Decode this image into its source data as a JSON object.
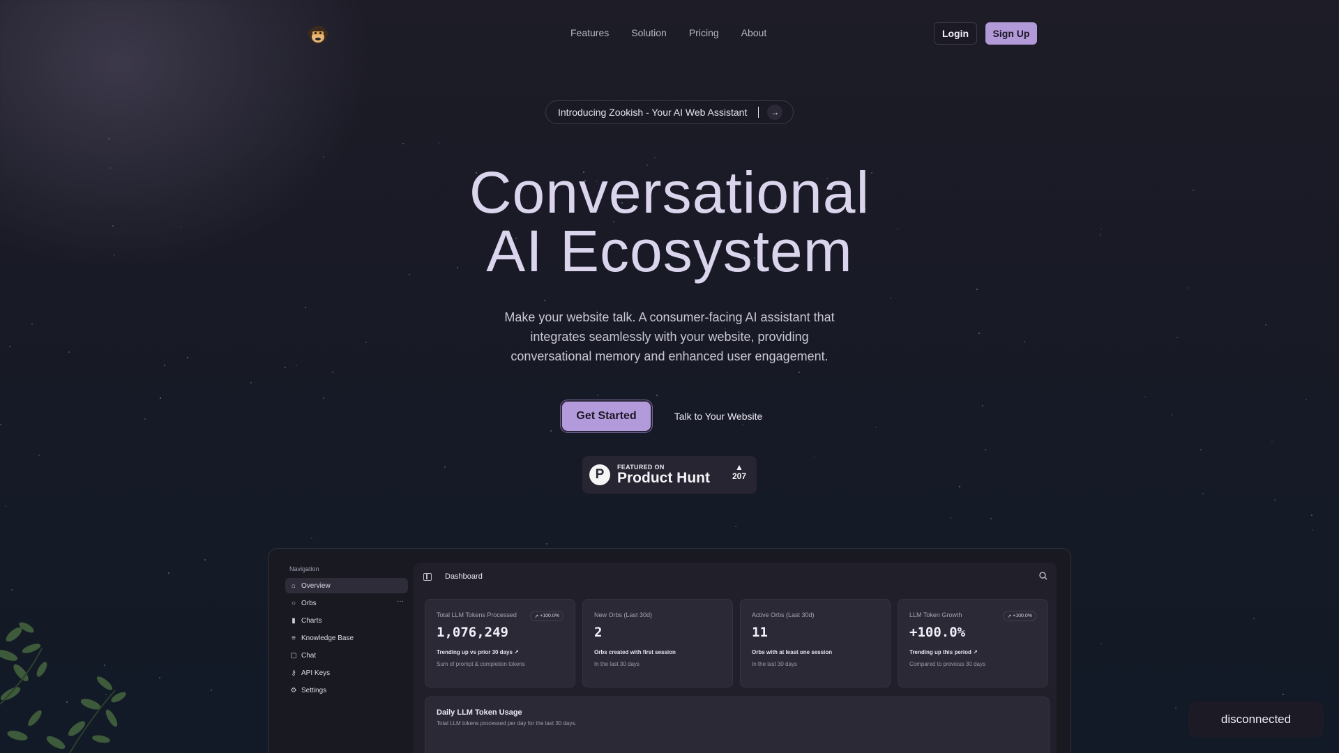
{
  "nav": {
    "links": [
      "Features",
      "Solution",
      "Pricing",
      "About"
    ],
    "login_label": "Login",
    "signup_label": "Sign Up"
  },
  "announcement": {
    "text": "Introducing Zookish - Your AI Web Assistant"
  },
  "hero": {
    "title_line1": "Conversational",
    "title_line2": "AI Ecosystem",
    "subtitle": "Make your website talk. A consumer-facing AI assistant that integrates seamlessly with your website, providing conversational memory and enhanced user engagement.",
    "cta_primary": "Get Started",
    "cta_secondary": "Talk to Your Website"
  },
  "product_hunt": {
    "featured_on": "FEATURED ON",
    "name": "Product Hunt",
    "letter": "P",
    "upvotes": "207"
  },
  "dashboard": {
    "nav_heading": "Navigation",
    "nav_items": [
      "Overview",
      "Orbs",
      "Charts",
      "Knowledge Base",
      "Chat",
      "API Keys",
      "Settings"
    ],
    "more_glyph": "···",
    "title": "Dashboard",
    "cards": [
      {
        "label": "Total LLM Tokens Processed",
        "badge": "+100.0%",
        "value": "1,076,249",
        "line1": "Trending up vs prior 30 days",
        "line2": "Sum of prompt & completion tokens"
      },
      {
        "label": "New Orbs (Last 30d)",
        "badge": "",
        "value": "2",
        "line1": "Orbs created with first session",
        "line2": "In the last 30 days"
      },
      {
        "label": "Active Orbs (Last 30d)",
        "badge": "",
        "value": "11",
        "line1": "Orbs with at least one session",
        "line2": "In the last 30 days"
      },
      {
        "label": "LLM Token Growth",
        "badge": "+100.0%",
        "value": "+100.0%",
        "line1": "Trending up this period",
        "line2": "Compared to previous 30 days"
      }
    ],
    "usage_title": "Daily LLM Token Usage",
    "usage_subtitle": "Total LLM tokens processed per day for the last 30 days."
  },
  "connection_status": "disconnected",
  "colors": {
    "accent": "#b29ad9",
    "background": "#181a25",
    "card": "#2a2935"
  },
  "icons": [
    "monkey-logo-icon",
    "arrow-right-icon",
    "triangle-up-icon",
    "home-icon",
    "circle-icon",
    "bar-chart-icon",
    "database-icon",
    "chat-bubble-icon",
    "key-icon",
    "gear-icon",
    "panel-toggle-icon",
    "search-icon",
    "trending-up-icon"
  ]
}
